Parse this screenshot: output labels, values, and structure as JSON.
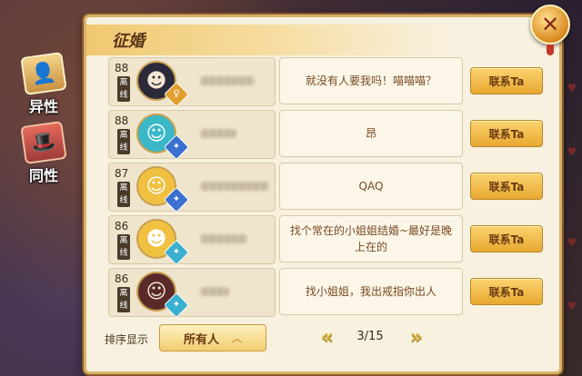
{
  "header": {
    "title": "征婚"
  },
  "sidebar": {
    "tabs": [
      {
        "label": "异性",
        "icon": "person-icon",
        "active": true
      },
      {
        "label": "同性",
        "icon": "hat-icon",
        "active": false
      }
    ]
  },
  "rows": [
    {
      "level": "88",
      "status": "离线",
      "message": "就没有人要我吗！喵喵喵？",
      "button": "联系Ta",
      "avatar_color": "#2a2a3a",
      "avatar_glyph": "☻",
      "badge_color": "#e0a030",
      "badge_glyph": "♀"
    },
    {
      "level": "88",
      "status": "离线",
      "message": "昂",
      "button": "联系Ta",
      "avatar_color": "#3ab8c8",
      "avatar_glyph": "☺",
      "badge_color": "#3a70d0",
      "badge_glyph": "✦"
    },
    {
      "level": "87",
      "status": "离线",
      "message": "QAQ",
      "button": "联系Ta",
      "avatar_color": "#f0c040",
      "avatar_glyph": "☺",
      "badge_color": "#3a70d0",
      "badge_glyph": "✦"
    },
    {
      "level": "86",
      "status": "离线",
      "message": "找个常在的小姐姐结婚~最好是晚上在的",
      "button": "联系Ta",
      "avatar_color": "#f0c040",
      "avatar_glyph": "☻",
      "badge_color": "#3ab0d0",
      "badge_glyph": "✦"
    },
    {
      "level": "86",
      "status": "离线",
      "message": "找小姐姐，我出戒指你出人",
      "button": "联系Ta",
      "avatar_color": "#5a2a2a",
      "avatar_glyph": "☺",
      "badge_color": "#3ab0d0",
      "badge_glyph": "✦"
    }
  ],
  "footer": {
    "sort_label": "排序显示",
    "sort_value": "所有人",
    "page": "3/15"
  }
}
